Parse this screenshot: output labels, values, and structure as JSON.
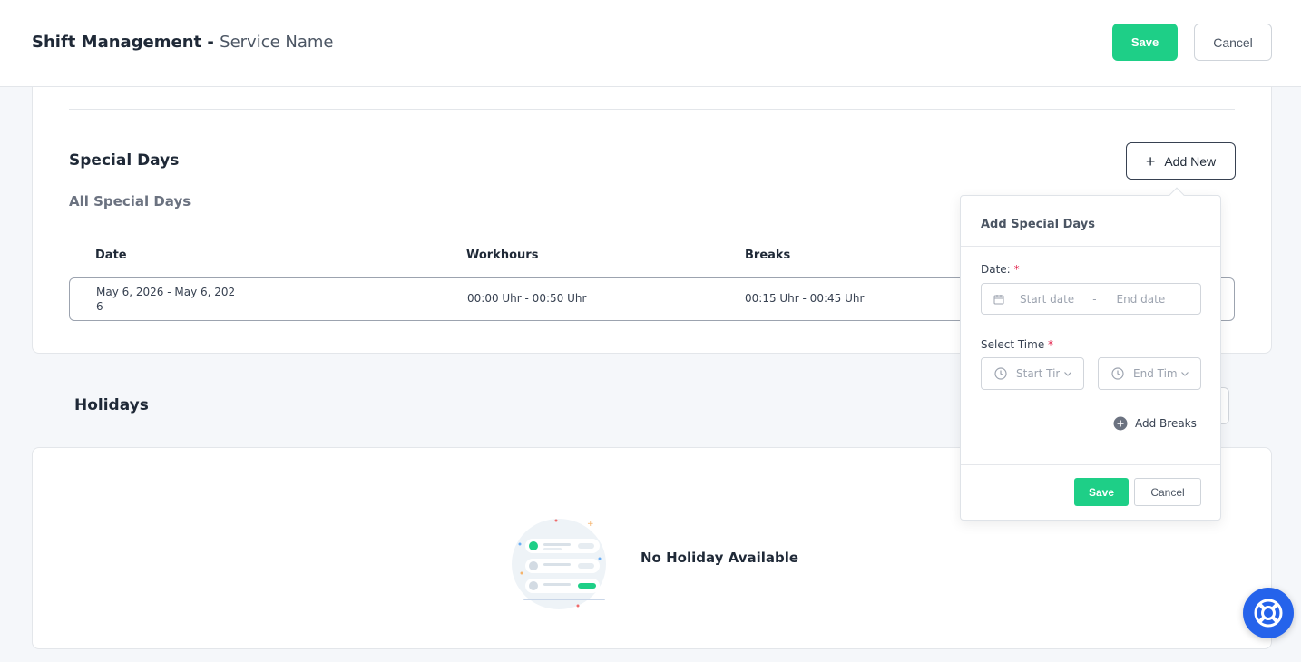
{
  "header": {
    "title": "Shift Management - ",
    "service_name": "Service Name",
    "save_label": "Save",
    "cancel_label": "Cancel"
  },
  "special_days": {
    "title": "Special Days",
    "subtitle": "All Special Days",
    "add_new_label": "Add New",
    "table": {
      "headers": [
        "Date",
        "Workhours",
        "Breaks"
      ],
      "rows": [
        {
          "date": "May 6, 2026 - May 6, 2026",
          "workhours": "00:00 Uhr - 00:50 Uhr",
          "breaks": "00:15 Uhr - 00:45 Uhr"
        }
      ]
    }
  },
  "holidays": {
    "title": "Holidays",
    "empty_text": "No Holiday Available"
  },
  "popover": {
    "title": "Add Special Days",
    "date_label": "Date:",
    "required_mark": "*",
    "start_date_placeholder": "Start date",
    "date_separator": "-",
    "end_date_placeholder": "End date",
    "time_label": "Select Time",
    "start_time_placeholder": "Start Time",
    "end_time_placeholder": "End Time",
    "add_breaks_label": "Add Breaks",
    "save_label": "Save",
    "cancel_label": "Cancel"
  },
  "colors": {
    "accent_green": "#1ecf87",
    "help_blue": "#2563eb",
    "required_red": "#e11d48"
  },
  "icons": {
    "add": "plus-icon",
    "calendar": "calendar-icon",
    "clock": "clock-icon",
    "chevron": "chevron-down-icon",
    "add_breaks": "plus-circle-icon",
    "help": "lifebuoy-icon"
  }
}
